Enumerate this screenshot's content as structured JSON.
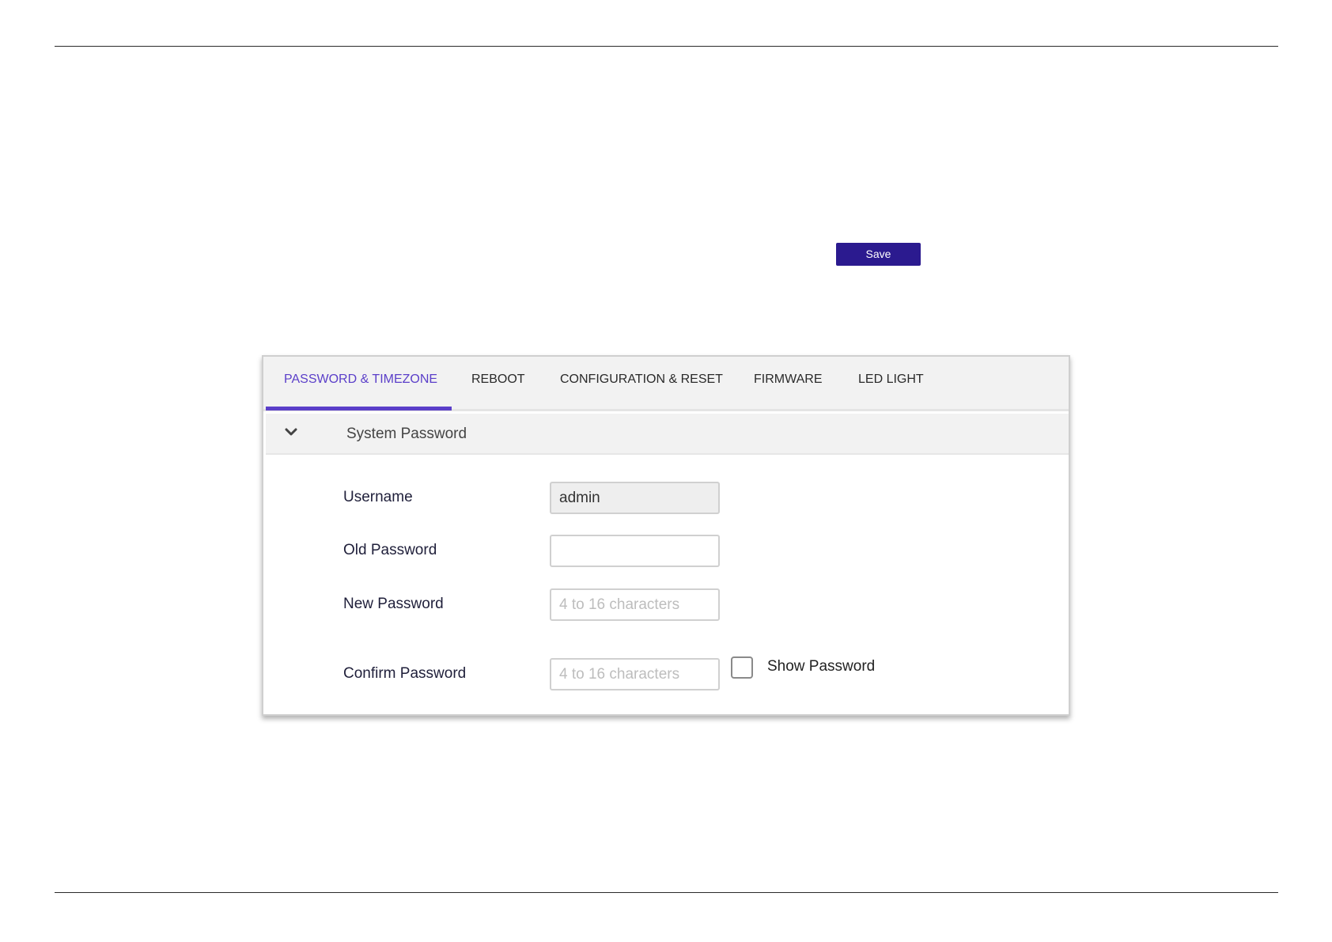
{
  "toolbar": {
    "save_label": "Save",
    "save_color": "#2b1a8f"
  },
  "tabs": [
    {
      "label": "PASSWORD & TIMEZONE",
      "active": true
    },
    {
      "label": "REBOOT",
      "active": false
    },
    {
      "label": "CONFIGURATION & RESET",
      "active": false
    },
    {
      "label": "FIRMWARE",
      "active": false
    },
    {
      "label": "LED LIGHT",
      "active": false
    }
  ],
  "accent_color": "#5b3fc9",
  "section": {
    "title": "System Password",
    "icon": "chevron-down-icon",
    "expanded": true
  },
  "form": {
    "username": {
      "label": "Username",
      "value": "admin"
    },
    "old_password": {
      "label": "Old Password",
      "value": ""
    },
    "new_password": {
      "label": "New Password",
      "placeholder": "4 to 16 characters"
    },
    "confirm_password": {
      "label": "Confirm Password",
      "placeholder": "4 to 16 characters"
    },
    "show_password": {
      "label": "Show Password",
      "checked": false
    }
  }
}
